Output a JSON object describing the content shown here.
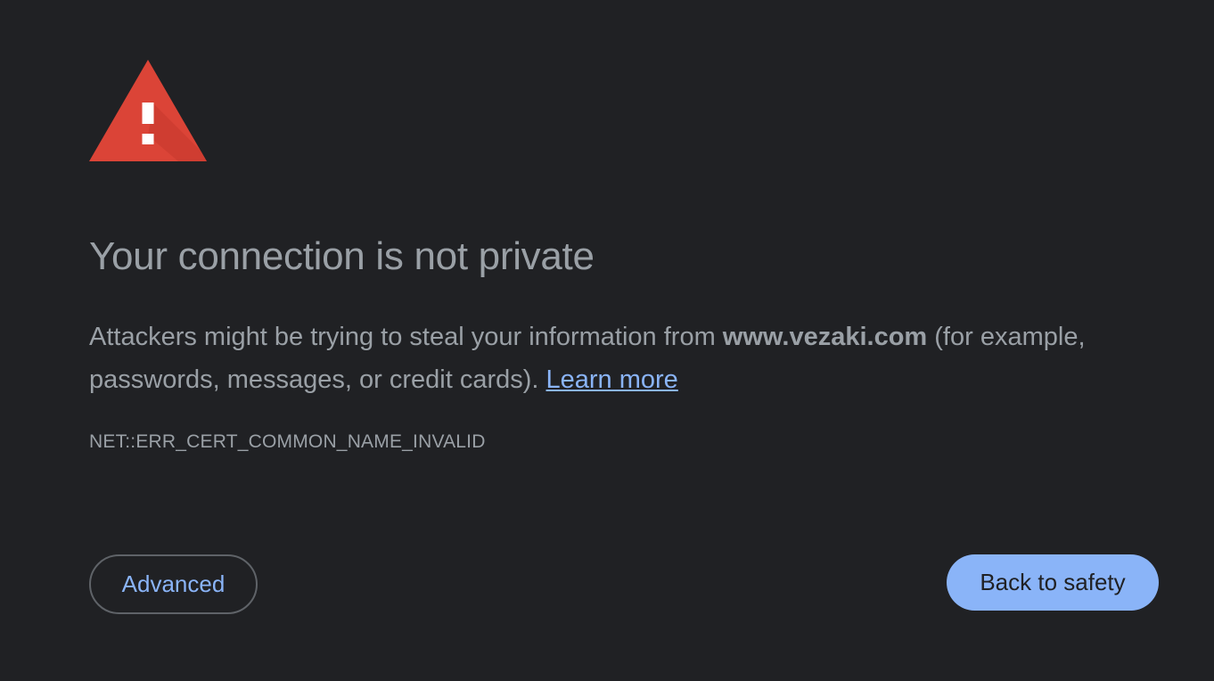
{
  "icon": {
    "name": "warning-triangle-icon",
    "color": "#db4437",
    "glyph": "!"
  },
  "main": {
    "heading": "Your connection is not private",
    "explanation": {
      "before": "Attackers might be trying to steal your information from ",
      "domain": "www.vezaki.com",
      "after": " (for example, passwords, messages, or credit cards). ",
      "learn_more": "Learn more"
    },
    "error_code": "NET::ERR_CERT_COMMON_NAME_INVALID"
  },
  "buttons": {
    "advanced": "Advanced",
    "back_to_safety": "Back to safety"
  },
  "colors": {
    "background": "#202124",
    "text": "#9aa0a6",
    "accent": "#8ab4f8",
    "button_border": "#5f6368"
  }
}
